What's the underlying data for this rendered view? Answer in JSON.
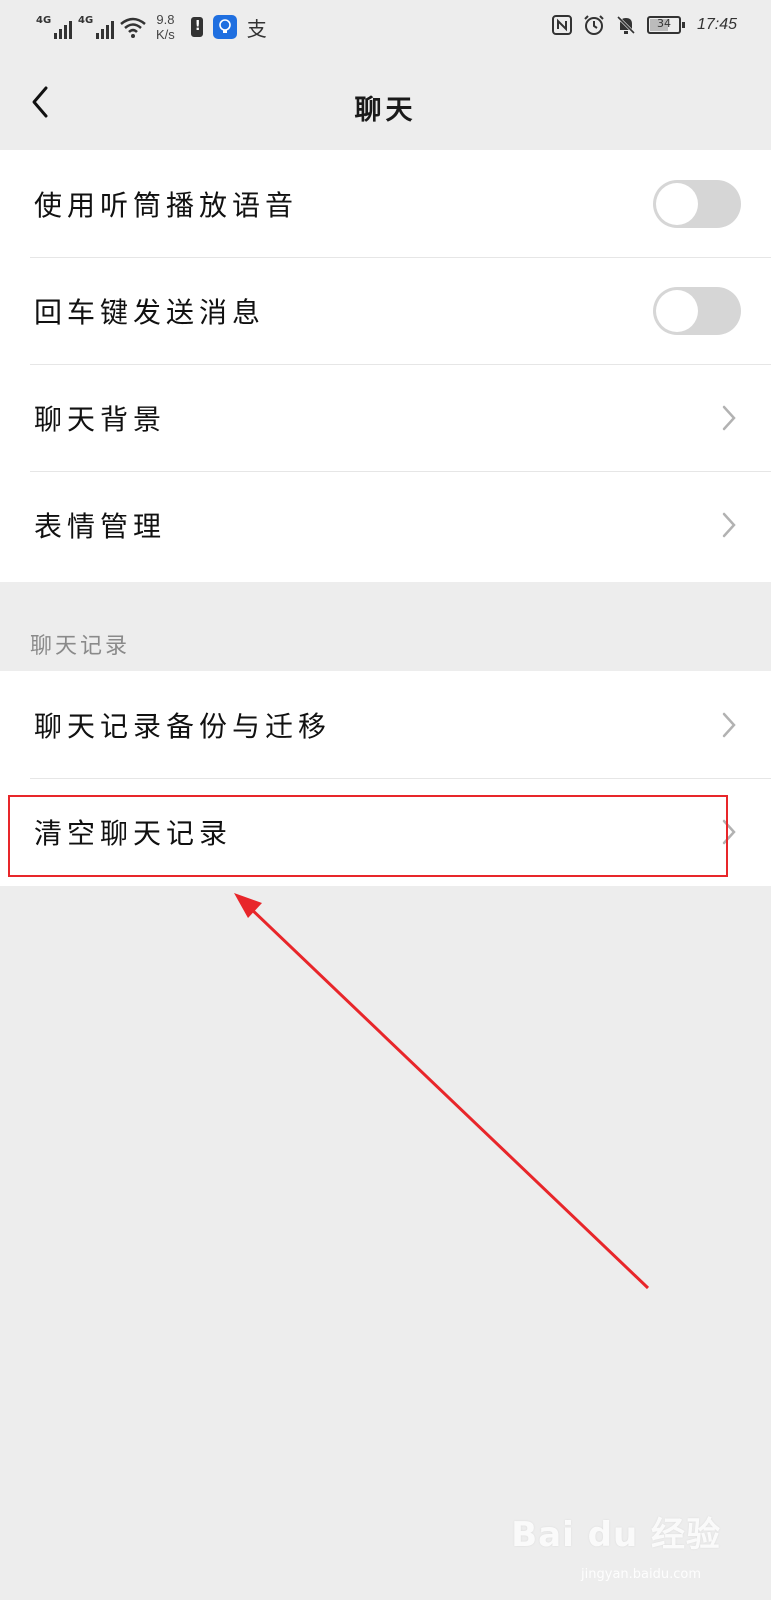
{
  "status_bar": {
    "signal1_label": "4G",
    "signal2_label": "4G",
    "speed_value": "9.8",
    "speed_unit": "K/s",
    "alipay_glyph": "支",
    "battery_level": "34",
    "time": "17:45",
    "icons": [
      "signal-icon",
      "wifi-icon",
      "battery-warning-icon",
      "bulb-app-icon",
      "alipay-icon",
      "nfc-icon",
      "alarm-icon",
      "mute-icon",
      "battery-icon"
    ]
  },
  "nav": {
    "title": "聊天",
    "back_icon": "chevron-left-icon"
  },
  "settings": {
    "items": [
      {
        "label": "使用听筒播放语音",
        "control": "toggle",
        "checked": false
      },
      {
        "label": "回车键发送消息",
        "control": "toggle",
        "checked": false
      },
      {
        "label": "聊天背景",
        "control": "chevron"
      },
      {
        "label": "表情管理",
        "control": "chevron"
      }
    ]
  },
  "chat_history": {
    "section_label": "聊天记录",
    "items": [
      {
        "label": "聊天记录备份与迁移",
        "control": "chevron"
      },
      {
        "label": "清空聊天记录",
        "control": "chevron",
        "highlighted": true
      }
    ]
  },
  "annotation": {
    "color": "#e8262a"
  },
  "watermark": {
    "text": "Bai du 经验",
    "sub": "jingyan.baidu.com"
  },
  "colors": {
    "background": "#ededed",
    "card": "#ffffff",
    "toggle_off": "#d6d6d6",
    "accent_blue": "#1f6fe0"
  }
}
